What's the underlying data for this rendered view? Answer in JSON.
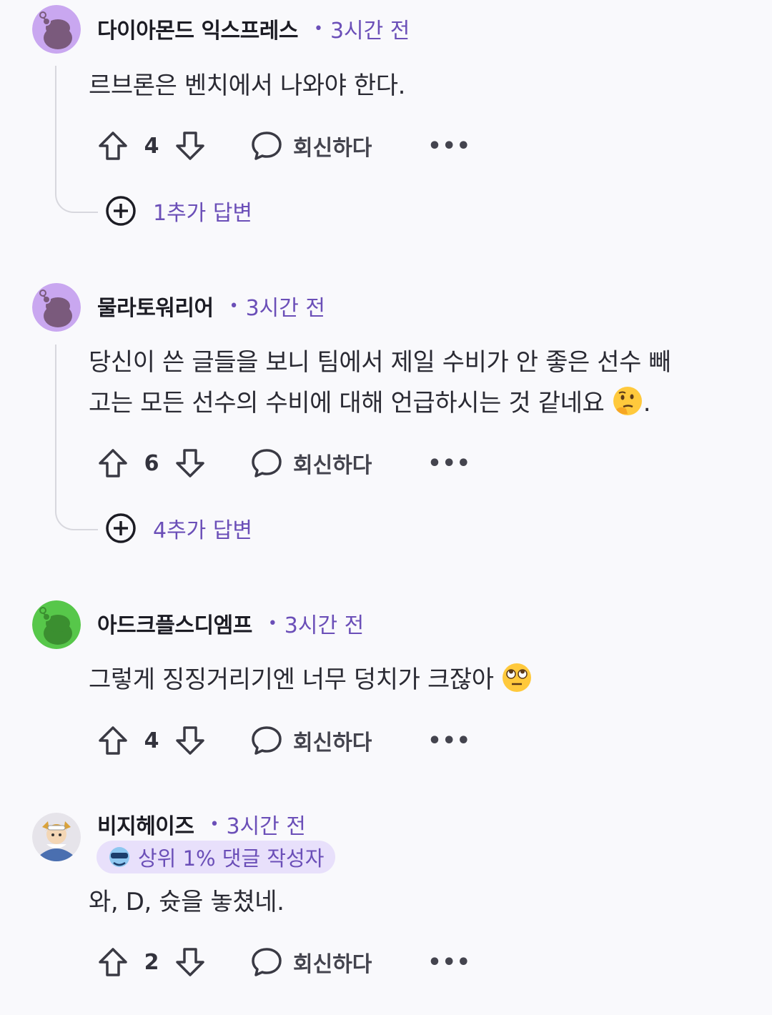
{
  "comments": [
    {
      "username": "다이아몬드 익스프레스",
      "time": "3시간 전",
      "body": "르브론은 벤치에서 나와야 한다.",
      "score": "4",
      "reply_label": "회신하다",
      "more_replies": "1추가 답변",
      "avatar_color": "#c9a7f0"
    },
    {
      "username": "물라토워리어",
      "time": "3시간 전",
      "body_line1": "당신이 쓴 글들을 보니 팀에서 제일 수비가 안 좋은 선수 빼",
      "body_line2": "고는 모든 선수의 수비에 대해 언급하시는 것 같네요",
      "body_end": ".",
      "score": "6",
      "reply_label": "회신하다",
      "more_replies": "4추가 답변",
      "avatar_color": "#c9a7f0"
    },
    {
      "username": "아드크플스디엠프",
      "time": "3시간 전",
      "body": "그렇게 징징거리기엔 너무 덩치가 크잖아",
      "score": "4",
      "reply_label": "회신하다",
      "avatar_color": "#57c74a"
    },
    {
      "username": "비지헤이즈",
      "time": "3시간 전",
      "badge": "상위 1% 댓글 작성자",
      "body": "와, D, 슛을 놓쳤네.",
      "score": "2",
      "reply_label": "회신하다"
    }
  ],
  "more_icon": "ellipsis-icon",
  "accent_color": "#6b4fb8"
}
